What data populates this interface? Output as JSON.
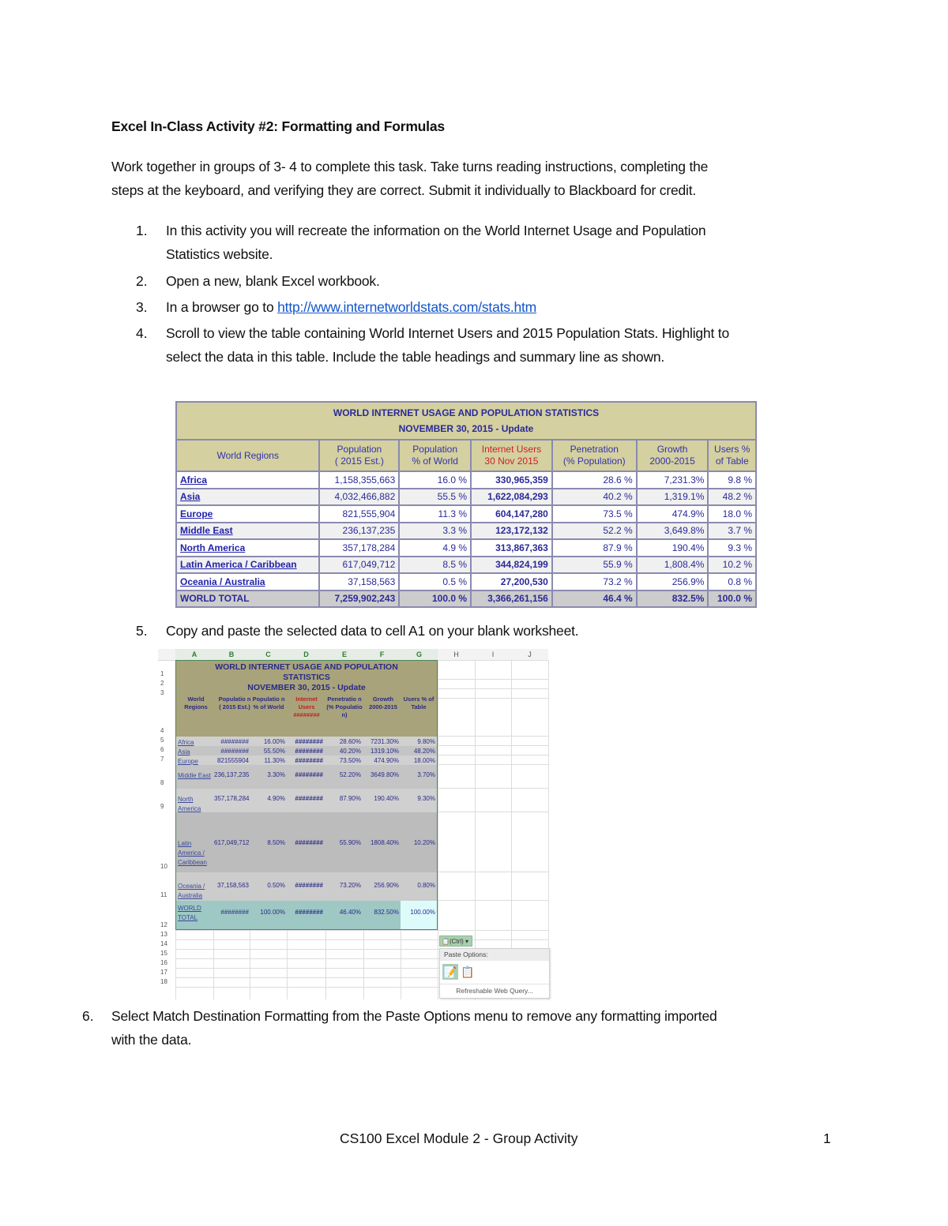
{
  "document": {
    "title": "Excel In-Class Activity #2: Formatting and Formulas",
    "intro_line1": "Work together in groups of 3- 4 to complete this task.  Take turns reading instructions, completing the",
    "intro_line2": "steps at the keyboard, and verifying they are correct. Submit it individually to Blackboard for credit.",
    "steps": [
      {
        "num": "1.",
        "line1": "In this activity you will recreate the information on the World Internet Usage and Population",
        "line2": "Statistics website."
      },
      {
        "num": "2.",
        "line1": "Open a new, blank Excel workbook."
      },
      {
        "num": "3.",
        "line1": "In a browser go to ",
        "link": "http://www.internetworldstats.com/stats.htm"
      },
      {
        "num": "4.",
        "line1": "Scroll to view the table containing World Internet Users and 2015 Population Stats.  Highlight to",
        "line2": "select the data in this table.   Include the table headings and summary line as shown."
      },
      {
        "num": "5.",
        "line1": "Copy and paste the selected data to cell A1 on your blank worksheet."
      },
      {
        "num": "6.",
        "line1": "Select Match Destination Formatting from the Paste Options menu to remove any formatting imported",
        "line2": "with the data."
      }
    ],
    "footer_text": "CS100 Excel Module 2 - Group Activity",
    "page_number": "1"
  },
  "web_table": {
    "title_line1": "WORLD INTERNET USAGE AND POPULATION STATISTICS",
    "title_line2": "NOVEMBER 30, 2015 - Update",
    "headers": [
      {
        "line1": "World Regions",
        "line2": ""
      },
      {
        "line1": "Population",
        "line2": "( 2015 Est.)"
      },
      {
        "line1": "Population",
        "line2": "% of World"
      },
      {
        "line1": "Internet Users",
        "line2": "30 Nov 2015"
      },
      {
        "line1": "Penetration",
        "line2": "(% Population)"
      },
      {
        "line1": "Growth",
        "line2": "2000-2015"
      },
      {
        "line1": "Users %",
        "line2": "of Table"
      }
    ],
    "rows": [
      {
        "region": "Africa",
        "population": "1,158,355,663",
        "pct_world": "16.0 %",
        "internet_users": "330,965,359",
        "penetration": "28.6 %",
        "growth": "7,231.3%",
        "users_pct": "9.8 %"
      },
      {
        "region": "Asia",
        "population": "4,032,466,882",
        "pct_world": "55.5 %",
        "internet_users": "1,622,084,293",
        "penetration": "40.2 %",
        "growth": "1,319.1%",
        "users_pct": "48.2 %"
      },
      {
        "region": "Europe",
        "population": "821,555,904",
        "pct_world": "11.3 %",
        "internet_users": "604,147,280",
        "penetration": "73.5 %",
        "growth": "474.9%",
        "users_pct": "18.0 %"
      },
      {
        "region": "Middle East",
        "population": "236,137,235",
        "pct_world": "3.3 %",
        "internet_users": "123,172,132",
        "penetration": "52.2 %",
        "growth": "3,649.8%",
        "users_pct": "3.7 %"
      },
      {
        "region": "North America",
        "population": "357,178,284",
        "pct_world": "4.9 %",
        "internet_users": "313,867,363",
        "penetration": "87.9 %",
        "growth": "190.4%",
        "users_pct": "9.3 %"
      },
      {
        "region": "Latin America / Caribbean",
        "population": "617,049,712",
        "pct_world": "8.5 %",
        "internet_users": "344,824,199",
        "penetration": "55.9 %",
        "growth": "1,808.4%",
        "users_pct": "10.2 %"
      },
      {
        "region": "Oceania / Australia",
        "population": "37,158,563",
        "pct_world": "0.5 %",
        "internet_users": "27,200,530",
        "penetration": "73.2 %",
        "growth": "256.9%",
        "users_pct": "0.8 %"
      }
    ],
    "total": {
      "region": "WORLD TOTAL",
      "population": "7,259,902,243",
      "pct_world": "100.0 %",
      "internet_users": "3,366,261,156",
      "penetration": "46.4 %",
      "growth": "832.5%",
      "users_pct": "100.0 %"
    }
  },
  "excel": {
    "columns": [
      "A",
      "B",
      "C",
      "D",
      "E",
      "F",
      "G",
      "H",
      "I",
      "J"
    ],
    "row_numbers": [
      "1",
      "2",
      "3",
      "4",
      "5",
      "6",
      "7",
      "8",
      "9",
      "10",
      "11",
      "12",
      "13",
      "14",
      "15",
      "16",
      "17",
      "18"
    ],
    "title_line1": "WORLD INTERNET USAGE AND POPULATION",
    "title_line2": "STATISTICS",
    "title_line3": "NOVEMBER 30, 2015 - Update",
    "headers": [
      "World Regions",
      "Populatio n ( 2015 Est.)",
      "Populatio n % of World",
      "Internet Users ########",
      "Penetratio n (% Populatio n)",
      "Growth 2000-2015",
      "Users % of Table"
    ],
    "rows": [
      {
        "region": "Africa",
        "population": "########",
        "pct_world": "16.00%",
        "internet_users": "########",
        "penetration": "28.60%",
        "growth": "7231.30%",
        "users_pct": "9.80%"
      },
      {
        "region": "Asia",
        "population": "########",
        "pct_world": "55.50%",
        "internet_users": "########",
        "penetration": "40.20%",
        "growth": "1319.10%",
        "users_pct": "48.20%"
      },
      {
        "region": "Europe",
        "population": "821555904",
        "pct_world": "11.30%",
        "internet_users": "########",
        "penetration": "73.50%",
        "growth": "474.90%",
        "users_pct": "18.00%"
      },
      {
        "region": "Middle East",
        "population": "236,137,235",
        "pct_world": "3.30%",
        "internet_users": "########",
        "penetration": "52.20%",
        "growth": "3649.80%",
        "users_pct": "3.70%"
      },
      {
        "region": "North America",
        "population": "357,178,284",
        "pct_world": "4.90%",
        "internet_users": "########",
        "penetration": "87.90%",
        "growth": "190.40%",
        "users_pct": "9.30%"
      },
      {
        "region": "Latin America / Caribbean",
        "population": "617,049,712",
        "pct_world": "8.50%",
        "internet_users": "########",
        "penetration": "55.90%",
        "growth": "1808.40%",
        "users_pct": "10.20%"
      },
      {
        "region": "Oceania / Australia",
        "population": "37,158,563",
        "pct_world": "0.50%",
        "internet_users": "########",
        "penetration": "73.20%",
        "growth": "256.90%",
        "users_pct": "0.80%"
      }
    ],
    "total": {
      "region": "WORLD TOTAL",
      "population": "########",
      "pct_world": "100.00%",
      "internet_users": "########",
      "penetration": "46.40%",
      "growth": "832.50%",
      "users_pct": "100.00%"
    },
    "paste_button_label": "(Ctrl) ▾",
    "paste_menu_title": "Paste Options:",
    "paste_menu_footer": "Refreshable Web Query...",
    "paste_icons": [
      "match-destination-formatting-icon",
      "keep-source-formatting-icon"
    ]
  },
  "colors": {
    "link": "#1155cc",
    "table_header_bg": "#d4d0a0",
    "table_text": "#2a2a99",
    "internet_users_header": "#cc2222",
    "excel_selection_border": "#4a8a5a"
  }
}
